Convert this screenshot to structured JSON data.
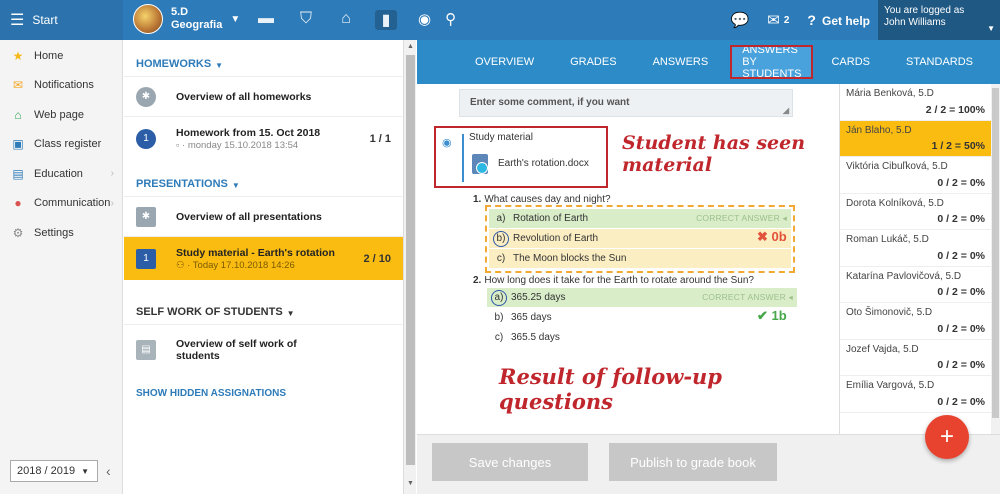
{
  "topbar": {
    "start_label": "Start",
    "class_name": "5.D",
    "subject": "Geografia",
    "mail_count": "2",
    "help_label": "Get help",
    "logged_label": "You are logged as",
    "user_name": "John Williams"
  },
  "sidebar": {
    "items": [
      {
        "label": "Home",
        "icon": "star-icon"
      },
      {
        "label": "Notifications",
        "icon": "envelope-icon"
      },
      {
        "label": "Web page",
        "icon": "home-icon"
      },
      {
        "label": "Class register",
        "icon": "register-icon"
      },
      {
        "label": "Education",
        "icon": "books-icon"
      },
      {
        "label": "Communication",
        "icon": "chat-icon"
      },
      {
        "label": "Settings",
        "icon": "gear-icon"
      }
    ],
    "year": "2018 / 2019"
  },
  "assignments": {
    "homeworks_header": "HOMEWORKS",
    "hw_overview": "Overview of all homeworks",
    "hw_title": "Homework from 15. Oct 2018",
    "hw_date": "monday 15.10.2018 13:54",
    "hw_count": "1 / 1",
    "hw_badge": "1",
    "presentations_header": "PRESENTATIONS",
    "pres_overview": "Overview of all presentations",
    "pres_title": "Study material - Earth's rotation",
    "pres_date": "Today 17.10.2018 14:26",
    "pres_count": "2 / 10",
    "pres_badge": "1",
    "self_header": "SELF WORK OF STUDENTS",
    "self_overview": "Overview of self work of students",
    "hidden_link": "SHOW HIDDEN ASSIGNATIONS"
  },
  "tabs": [
    "OVERVIEW",
    "GRADES",
    "ANSWERS",
    "ANSWERS BY STUDENTS",
    "CARDS",
    "STANDARDS"
  ],
  "content": {
    "comment_placeholder": "Enter some comment, if you want",
    "material_label": "Study material",
    "material_file": "Earth's rotation.docx",
    "annotation_seen": "Student has seen material",
    "annotation_result": "Result of follow-up questions",
    "q1": {
      "num": "1.",
      "text": "What causes day and night?",
      "options": [
        {
          "letter": "a)",
          "text": "Rotation of Earth"
        },
        {
          "letter": "b)",
          "text": "Revolution of Earth"
        },
        {
          "letter": "c)",
          "text": "The Moon blocks the Sun"
        }
      ],
      "score": "✖ 0b"
    },
    "q2": {
      "num": "2.",
      "text": "How long does it take for the Earth to rotate around the Sun?",
      "options": [
        {
          "letter": "a)",
          "text": "365.25 days"
        },
        {
          "letter": "b)",
          "text": "365 days"
        },
        {
          "letter": "c)",
          "text": "365.5 days"
        }
      ],
      "score": "✔ 1b"
    },
    "correct_label": "CORRECT ANSWER"
  },
  "students": [
    {
      "name": "Mária Benková, 5.D",
      "score": "2 / 2 = 100%"
    },
    {
      "name": "Ján Blaho, 5.D",
      "score": "1 / 2 = 50%"
    },
    {
      "name": "Viktória Cibuľková, 5.D",
      "score": "0 / 2 = 0%"
    },
    {
      "name": "Dorota Kolníková, 5.D",
      "score": "0 / 2 = 0%"
    },
    {
      "name": "Roman Lukáč, 5.D",
      "score": "0 / 2 = 0%"
    },
    {
      "name": "Katarína Pavlovičová, 5.D",
      "score": "0 / 2 = 0%"
    },
    {
      "name": "Oto Šimonovič, 5.D",
      "score": "0 / 2 = 0%"
    },
    {
      "name": "Jozef Vajda, 5.D",
      "score": "0 / 2 = 0%"
    },
    {
      "name": "Emília Vargová, 5.D",
      "score": "0 / 2 = 0%"
    }
  ],
  "footer": {
    "save_label": "Save changes",
    "publish_label": "Publish to grade book",
    "fab_label": "+"
  }
}
